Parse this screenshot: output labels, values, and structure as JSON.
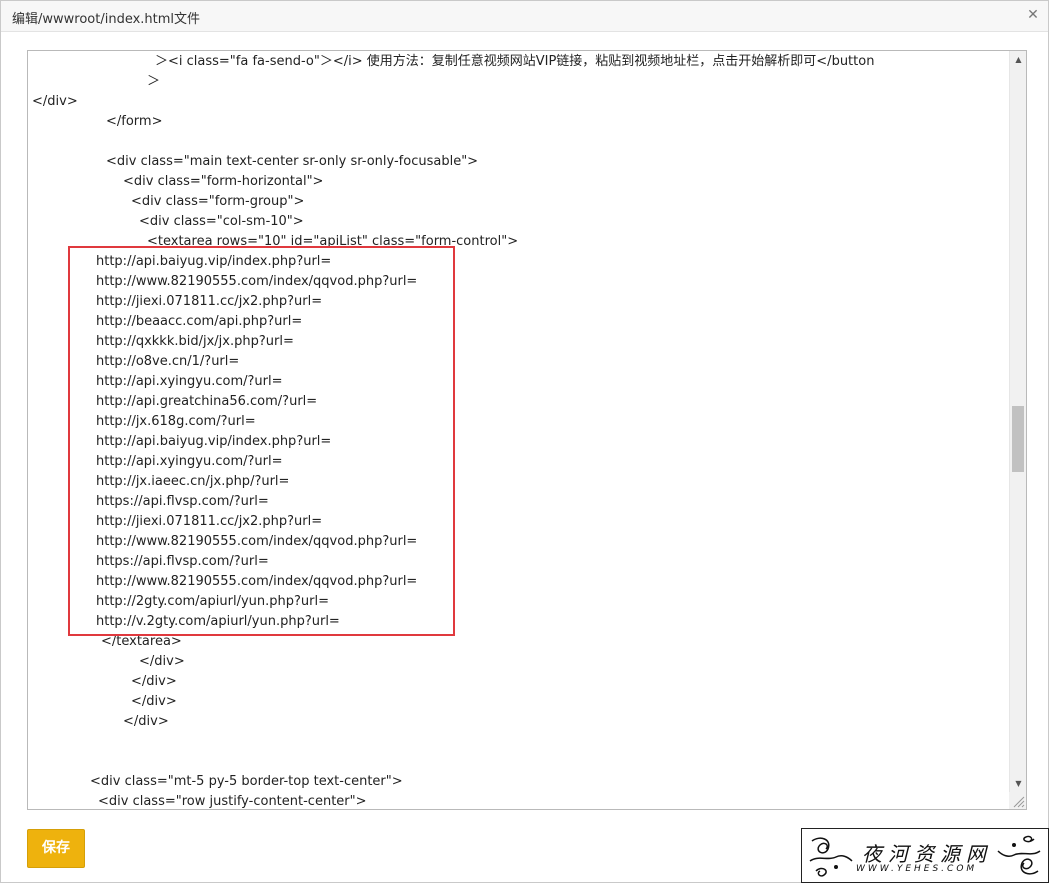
{
  "window": {
    "title": "编辑/wwwroot/index.html文件",
    "close_icon": "close-icon"
  },
  "editor": {
    "lines": [
      "＞<i class=\"fa fa-send-o\"＞</i> 使用方法：复制任意视频网站VIP链接，粘贴到视频地址栏，点击开始解析即可</button",
      "＞",
      "</div>",
      "</form>",
      "",
      "<div class=\"main text-center sr-only sr-only-focusable\">",
      "<div class=\"form-horizontal\">",
      "<div class=\"form-group\">",
      "<div class=\"col-sm-10\">",
      "<textarea rows=\"10\" id=\"apiList\" class=\"form-control\">",
      "http://api.baiyug.vip/index.php?url=",
      "http://www.82190555.com/index/qqvod.php?url=",
      "http://jiexi.071811.cc/jx2.php?url=",
      "http://beaacc.com/api.php?url=",
      "http://qxkkk.bid/jx/jx.php?url=",
      "http://o8ve.cn/1/?url=",
      "http://api.xyingyu.com/?url=",
      "http://api.greatchina56.com/?url=",
      "http://jx.618g.com/?url=",
      "http://api.baiyug.vip/index.php?url=",
      "http://api.xyingyu.com/?url=",
      "http://jx.iaeec.cn/jx.php/?url=",
      "https://api.flvsp.com/?url=",
      "http://jiexi.071811.cc/jx2.php?url=",
      "http://www.82190555.com/index/qqvod.php?url=",
      "https://api.flvsp.com/?url=",
      "http://www.82190555.com/index/qqvod.php?url=",
      "http://2gty.com/apiurl/yun.php?url=",
      "http://v.2gty.com/apiurl/yun.php?url=",
      "</textarea>",
      "</div>",
      "</div>",
      "</div>",
      "</div>",
      "",
      "",
      "<div class=\"mt-5 py-5 border-top text-center\">",
      "<div class=\"row justify-content-center\">"
    ],
    "scroll_position": 0.47
  },
  "highlight": {
    "color": "#e0393e"
  },
  "actions": {
    "save_label": "保存",
    "save_color": "#eeb20d"
  },
  "watermark": {
    "title": "夜河资源网",
    "url": "WWW.YEHES.COM"
  }
}
